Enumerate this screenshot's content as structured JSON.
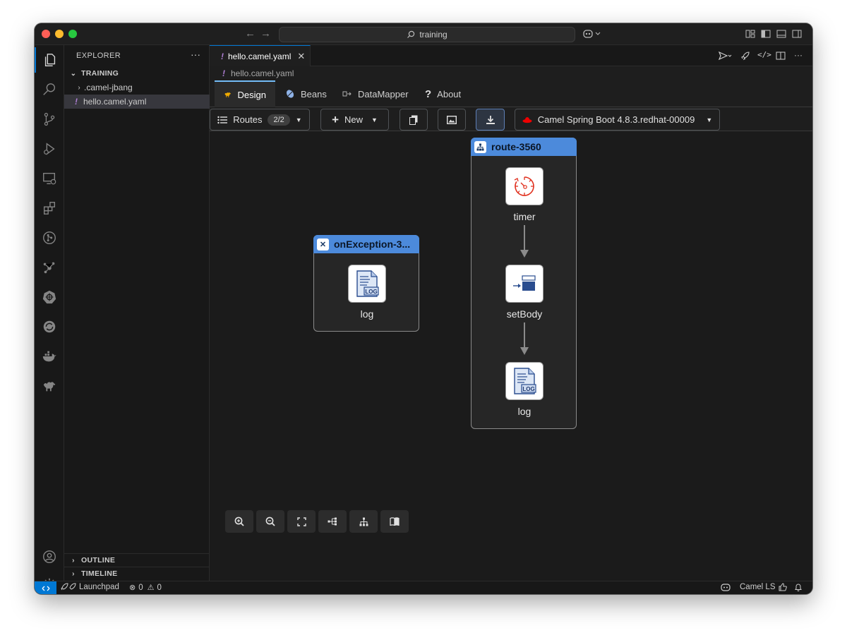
{
  "window": {
    "search_text": "training"
  },
  "sidebar": {
    "header": "EXPLORER",
    "more": "···",
    "folder": "TRAINING",
    "items": [
      {
        "label": ".camel-jbang",
        "type": "folder"
      },
      {
        "label": "hello.camel.yaml",
        "type": "file",
        "prefix": "!"
      }
    ],
    "outline": "OUTLINE",
    "timeline": "TIMELINE"
  },
  "editor": {
    "tab_label": "hello.camel.yaml",
    "tab_prefix": "!",
    "breadcrumb": "hello.camel.yaml",
    "breadcrumb_prefix": "!"
  },
  "kaoto": {
    "tabs": [
      {
        "label": "Design",
        "icon": "camel-icon",
        "active": true
      },
      {
        "label": "Beans",
        "icon": "bean-icon"
      },
      {
        "label": "DataMapper",
        "icon": "datamapper-icon"
      },
      {
        "label": "About",
        "icon": "question-icon"
      }
    ],
    "toolbar": {
      "routes_label": "Routes",
      "routes_count": "2/2",
      "new_label": "New",
      "runtime_label": "Camel Spring Boot 4.8.3.redhat-00009"
    },
    "exception_route": {
      "title": "onException-3...",
      "steps": [
        {
          "label": "log",
          "icon": "log-icon"
        }
      ]
    },
    "main_route": {
      "title": "route-3560",
      "steps": [
        {
          "label": "timer",
          "icon": "timer-icon"
        },
        {
          "label": "setBody",
          "icon": "setbody-icon"
        },
        {
          "label": "log",
          "icon": "log-icon"
        }
      ]
    },
    "colors": {
      "route_header": "#4c8adb",
      "accent_blue": "#0078d4"
    }
  },
  "statusbar": {
    "launchpad": "Launchpad",
    "errors": "0",
    "warnings": "0",
    "language_server": "Camel LS"
  }
}
